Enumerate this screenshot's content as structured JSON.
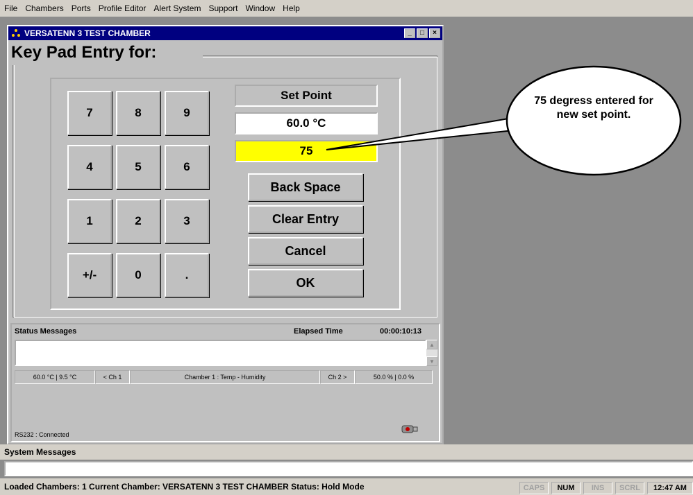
{
  "menu": [
    "File",
    "Chambers",
    "Ports",
    "Profile Editor",
    "Alert System",
    "Support",
    "Window",
    "Help"
  ],
  "window": {
    "title": "VERSATENN 3 TEST CHAMBER",
    "minimize": "_",
    "maximize": "□",
    "close": "×"
  },
  "heading": "Key Pad Entry for:",
  "keys": [
    "7",
    "8",
    "9",
    "4",
    "5",
    "6",
    "1",
    "2",
    "3",
    "+/-",
    "0",
    "."
  ],
  "setpoint": {
    "label": "Set Point",
    "current": "60.0 °C",
    "entry": "75"
  },
  "buttons": {
    "backspace": "Back Space",
    "clear": "Clear Entry",
    "cancel": "Cancel",
    "ok": "OK"
  },
  "status": {
    "title": "Status Messages",
    "elapsed_label": "Elapsed Time",
    "elapsed_value": "00:00:10:13",
    "ch1_values": "60.0 °C  |  9.5 °C",
    "prev_ch": "< Ch 1",
    "chamber": "Chamber 1 : Temp - Humidity",
    "next_ch": "Ch 2 >",
    "ch2_values": "50.0 %  |  0.0 %",
    "port": "RS232 : Connected"
  },
  "system": {
    "title": "System Messages"
  },
  "statusbar": {
    "text": "Loaded Chambers:  1    Current Chamber:    VERSATENN 3 TEST CHAMBER  Status:   Hold Mode",
    "caps": "CAPS",
    "num": "NUM",
    "ins": "INS",
    "scrl": "SCRL",
    "time": "12:47 AM"
  },
  "callout": {
    "text": "75 degress entered for new set point."
  },
  "colors": {
    "titlebar": "#000080",
    "entry_bg": "#ffff00",
    "desktop": "#8c8c8c"
  }
}
